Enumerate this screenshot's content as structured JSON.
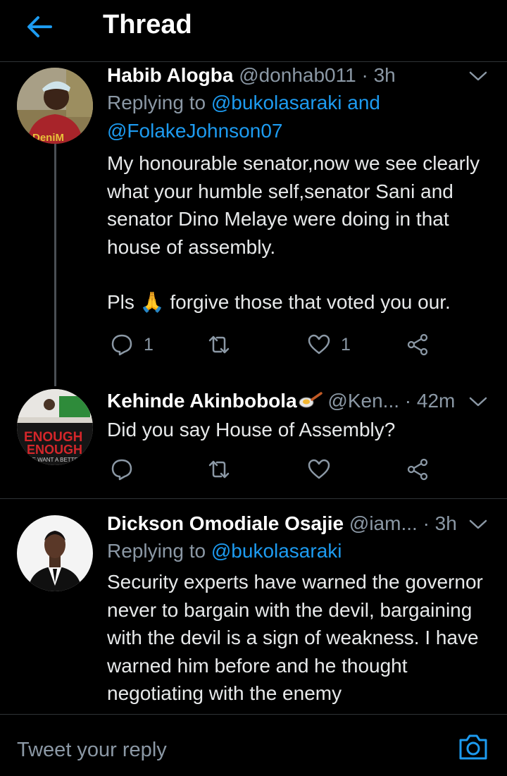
{
  "header": {
    "title": "Thread"
  },
  "tweets": [
    {
      "name": "Habib Alogba",
      "handle": "@donhab011",
      "time": "· 3h",
      "replying_prefix": "Replying to ",
      "replying_line1": "@bukolasaraki and",
      "replying_line2": "@FolakeJohnson07",
      "body_p1": "My honourable senator,now we see clearly what your humble self,senator Sani and senator Dino Melaye were doing in that house of assembly.",
      "body_p2_before": "Pls ",
      "emoji": "🙏",
      "body_p2_after": " forgive those that voted you our.",
      "reply_count": "1",
      "like_count": "1"
    },
    {
      "name": "Kehinde Akinbobola",
      "handle": "@Ken...",
      "time": "· 42m",
      "body": "Did you say House of Assembly?"
    },
    {
      "name": "Dickson Omodiale Osajie",
      "handle": "@iam...",
      "time": "· 3h",
      "replying_prefix": "Replying to ",
      "replying_line1": "@bukolasaraki",
      "body": "Security experts have warned the governor never to bargain with the devil, bargaining with the devil is a sign of weakness. I have warned him before and he thought negotiating with the enemy"
    }
  ],
  "avatar_texts": {
    "t1": "DeniM",
    "t2_line1": "ENOUGH",
    "t2_line2": "ENOUGH",
    "t2_small": "WE WANT A BETTER"
  },
  "composer": {
    "placeholder": "Tweet your reply"
  },
  "colors": {
    "accent": "#1d9bf0",
    "muted": "#8b98a5",
    "background": "#000000"
  },
  "icons": [
    "back-arrow-icon",
    "chevron-down-icon",
    "reply-icon",
    "retweet-icon",
    "like-icon",
    "share-icon",
    "camera-icon",
    "pan-emoji-icon"
  ]
}
